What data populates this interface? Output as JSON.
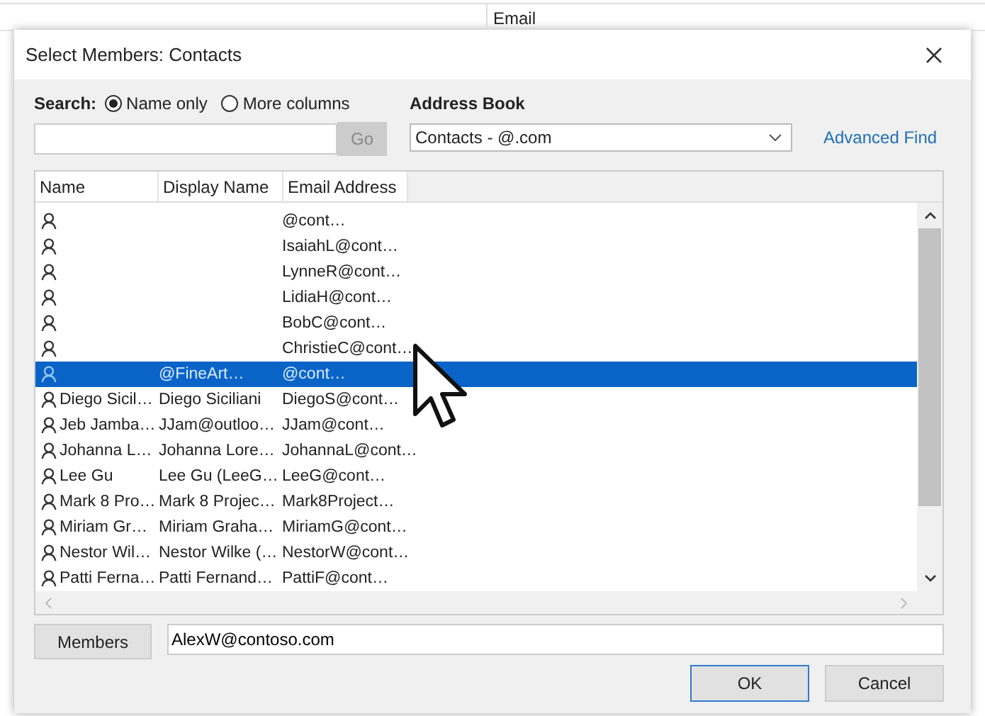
{
  "background": {
    "column_header": "Email"
  },
  "window": {
    "title": "Select Members: Contacts"
  },
  "search": {
    "label": "Search:",
    "options": [
      {
        "label": "Name only",
        "selected": true
      },
      {
        "label": "More columns",
        "selected": false
      }
    ],
    "go_button": "Go"
  },
  "address_book": {
    "label": "Address Book",
    "value": "Contacts - @.com",
    "advanced_find": "Advanced Find"
  },
  "table": {
    "columns": [
      "Name",
      "Display Name",
      "Email Address"
    ],
    "rows": [
      {
        "email": "@cont…",
        "selected": false
      },
      {
        "email": "IsaiahL@cont…",
        "selected": false
      },
      {
        "email": "LynneR@cont…",
        "selected": false
      },
      {
        "email": "LidiaH@cont…",
        "selected": false
      },
      {
        "email": "BobC@cont…",
        "selected": false
      },
      {
        "email": "ChristieC@cont…",
        "selected": false
      },
      {
        "display_name": "@FineArt…",
        "email": "@cont…",
        "selected": true
      },
      {
        "name": "Diego Sicil…",
        "display_name": "Diego Siciliani",
        "email": "DiegoS@cont…",
        "selected": false
      },
      {
        "name": "Jeb Jamba…",
        "display_name": "JJam@outloo…",
        "email": "JJam@cont…",
        "selected": false
      },
      {
        "name": "Johanna L…",
        "display_name": "Johanna Lore…",
        "email": "JohannaL@cont…",
        "selected": false
      },
      {
        "name": "Lee Gu",
        "display_name": "Lee Gu (LeeG…",
        "email": "LeeG@cont…",
        "selected": false
      },
      {
        "name": "Mark 8 Pro…",
        "display_name": "Mark 8 Projec…",
        "email": "Mark8Project…",
        "selected": false
      },
      {
        "name": "Miriam Gr…",
        "display_name": "Miriam Graha…",
        "email": "MiriamG@cont…",
        "selected": false
      },
      {
        "name": "Nestor Wil…",
        "display_name": "Nestor Wilke (…",
        "email": "NestorW@cont…",
        "selected": false
      },
      {
        "name": "Patti Ferna…",
        "display_name": "Patti Fernand…",
        "email": "PattiF@cont…",
        "selected": false
      }
    ]
  },
  "members": {
    "button": "Members",
    "value": "AlexW@contoso.com"
  },
  "buttons": [
    {
      "label": "OK",
      "kind": "default"
    },
    {
      "label": "Cancel",
      "kind": "normal"
    }
  ]
}
